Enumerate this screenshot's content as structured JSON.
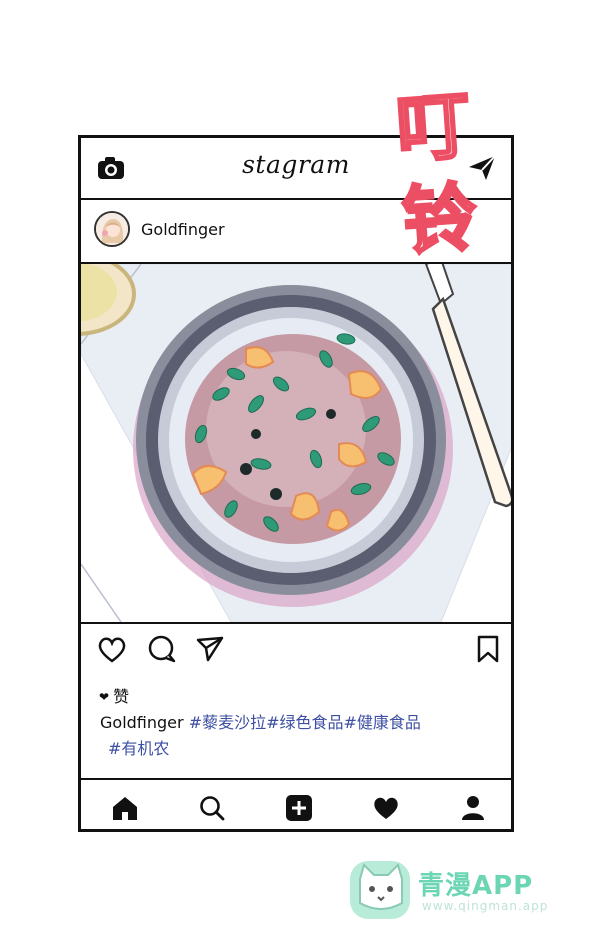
{
  "header": {
    "brand": "stagram"
  },
  "profile": {
    "username": "Goldfinger"
  },
  "post": {
    "likes_label": "赞",
    "caption_user": "Goldfinger",
    "hashtags_line1": "#藜麦沙拉#绿色食品#健康食品",
    "hashtags_line2": "#有机农"
  },
  "overlay": {
    "stamp_text": "叮铃"
  },
  "watermark": {
    "title": "青漫APP",
    "url": "www.qingman.app"
  },
  "colors": {
    "stamp": "#ec4f63",
    "hashtag": "#3d4fa3",
    "watermark": "#6cd6b4"
  },
  "icons": {
    "header": [
      "camera-icon",
      "send-icon"
    ],
    "actions": [
      "heart-icon",
      "comment-icon",
      "share-icon",
      "bookmark-icon"
    ],
    "nav": [
      "home-icon",
      "search-icon",
      "add-post-icon",
      "activity-heart-icon",
      "profile-icon"
    ]
  }
}
